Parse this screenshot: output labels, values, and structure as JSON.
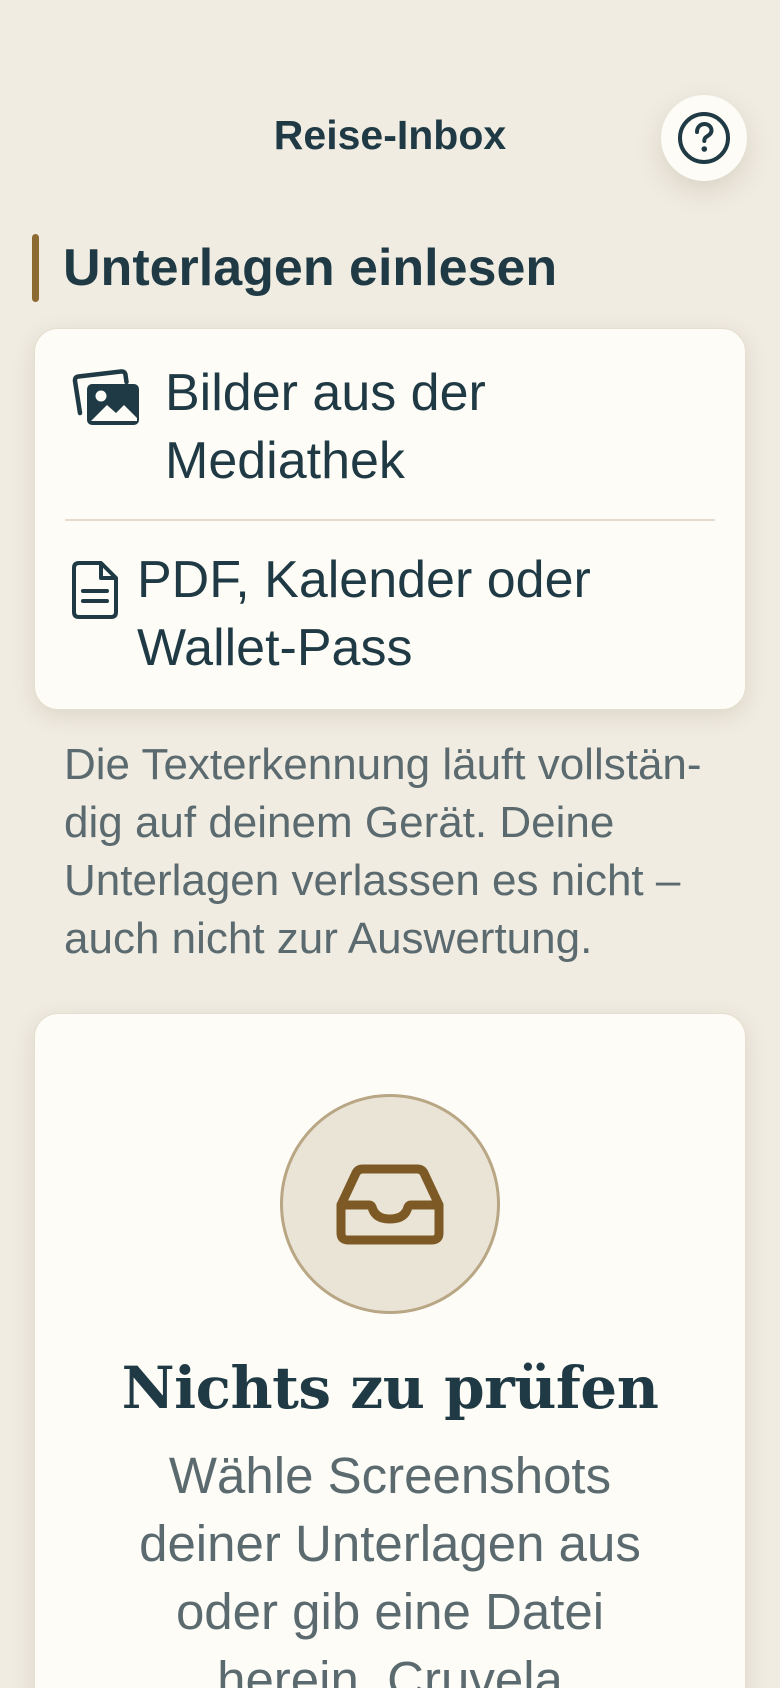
{
  "header": {
    "title": "Reise-Inbox",
    "help_icon": "question-circle-icon"
  },
  "import_section": {
    "heading": "Unterlagen einlesen",
    "accent_color": "#8d6a32",
    "options": [
      {
        "label": "Bilder aus der Mediathek",
        "icon": "photo-stack-icon"
      },
      {
        "label": "PDF, Kalender oder Wallet-Pass",
        "icon": "document-icon"
      }
    ],
    "privacy_note": "Die Texterkennung läuft vollstän­dig auf deinem Gerät. Deine Unterlagen verlassen es nicht – auch nicht zur Auswertung."
  },
  "empty_state": {
    "icon": "inbox-tray-icon",
    "title": "Nichts zu prüfen",
    "text": "Wähle Screenshots deiner Unterlagen aus oder gib eine Datei herein. Cruvela"
  },
  "colors": {
    "background": "#f0ece2",
    "card": "#fdfcf6",
    "primary_text": "#1f3a44",
    "secondary_text": "#5b6a6f",
    "accent": "#8d6a32"
  }
}
